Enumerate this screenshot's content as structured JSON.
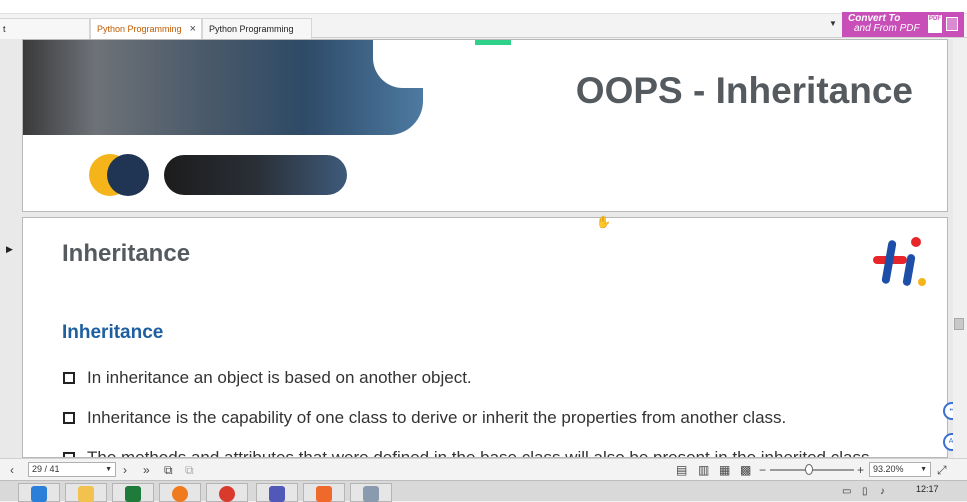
{
  "tabs": [
    {
      "label": "t",
      "active": false
    },
    {
      "label": "Python Programming",
      "active": true
    },
    {
      "label": "Python Programming",
      "active": false
    }
  ],
  "convert_button": {
    "line1": "Convert To",
    "line2": "and From PDF",
    "badge": "PDF"
  },
  "slide1": {
    "title": "OOPS - Inheritance"
  },
  "slide2": {
    "heading": "Inheritance",
    "subheading": "Inheritance",
    "bullets": [
      "In inheritance an object is based on another object.",
      "Inheritance is the capability of one class to derive or inherit the properties from another class.",
      "The methods and attributes that were defined in the base class will also be present in the inherited class."
    ]
  },
  "statusbar": {
    "page_indicator": "29 / 41",
    "zoom": "93.20%"
  },
  "taskbar": {
    "clock": "12:17"
  },
  "colors": {
    "accent_tab": "#c05a00",
    "convert_bg": "#c84fb8",
    "subheading": "#1d5fa0",
    "title_gray": "#555a5f"
  }
}
